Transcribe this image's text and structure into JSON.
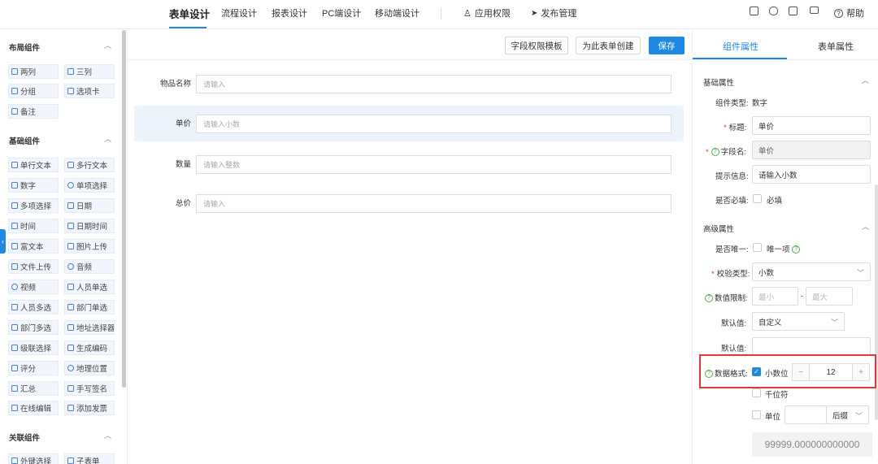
{
  "nav": {
    "tabs": [
      {
        "label": "表单设计",
        "active": true
      },
      {
        "label": "流程设计"
      },
      {
        "label": "报表设计"
      },
      {
        "label": "PC端设计"
      },
      {
        "label": "移动端设计"
      }
    ],
    "tools": [
      {
        "label": "应用权限",
        "icon": "user-icon"
      },
      {
        "label": "发布管理",
        "icon": "send-icon"
      }
    ],
    "icons": [
      "file-icon",
      "preview-icon",
      "code-icon",
      "monitor-icon"
    ],
    "help_label": "帮助"
  },
  "left": {
    "groups": [
      {
        "title": "布局组件",
        "items": [
          "两列",
          "三列",
          "分组",
          "选项卡",
          "备注"
        ]
      },
      {
        "title": "基础组件",
        "items": [
          "单行文本",
          "多行文本",
          "数字",
          "单项选择",
          "多项选择",
          "日期",
          "时间",
          "日期时间",
          "富文本",
          "图片上传",
          "文件上传",
          "音频",
          "视频",
          "人员单选",
          "人员多选",
          "部门单选",
          "部门多选",
          "地址选择器",
          "级联选择",
          "生成编码",
          "评分",
          "地理位置",
          "汇总",
          "手写签名",
          "在线编辑",
          "添加发票"
        ]
      },
      {
        "title": "关联组件",
        "items": [
          "外键选择",
          "子表单"
        ]
      }
    ]
  },
  "center": {
    "buttons": {
      "field_perm": "字段权限模板",
      "create": "为此表单创建",
      "save": "保存"
    },
    "fields": [
      {
        "label": "物品名称",
        "placeholder": "请输入"
      },
      {
        "label": "单价",
        "placeholder": "请输入小数"
      },
      {
        "label": "数量",
        "placeholder": "请输入整数"
      },
      {
        "label": "总价",
        "placeholder": "请输入"
      }
    ]
  },
  "right": {
    "tabs": [
      "组件属性",
      "表单属性"
    ],
    "basic_title": "基础属性",
    "comp_type_label": "组件类型:",
    "comp_type_value": "数字",
    "title_label": "标题:",
    "title_value": "单价",
    "field_label": "字段名:",
    "field_value": "单价",
    "hint_label": "提示信息:",
    "hint_value": "请输入小数",
    "required_label": "是否必填:",
    "required_text": "必填",
    "advanced_title": "高级属性",
    "unique_label": "是否唯一:",
    "unique_text": "唯一项",
    "validate_label": "校验类型:",
    "validate_value": "小数",
    "range_label": "数值限制:",
    "range_min_ph": "最小",
    "range_dash": "-",
    "range_max_ph": "最大",
    "default_label": "默认值:",
    "default_type_value": "自定义",
    "default_label2": "默认值:",
    "format_label": "数据格式:",
    "decimal_label": "小数位",
    "decimal_value": "12",
    "thousands_label": "千位符",
    "unit_label": "单位",
    "unit_pos": "后缀",
    "preview_value": "99999.000000000000"
  }
}
